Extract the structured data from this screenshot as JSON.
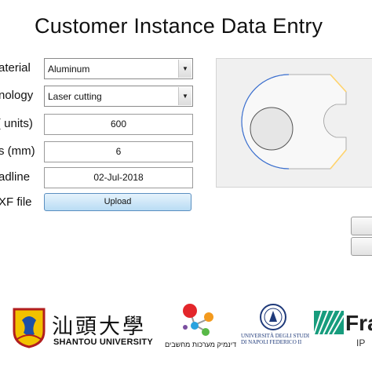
{
  "window": {
    "title": "Customer Instance Data Entry"
  },
  "form": {
    "material": {
      "label": "aterial",
      "value": "Aluminum",
      "icon": "chevron-down-icon"
    },
    "technology": {
      "label": "nology",
      "value": "Laser cutting",
      "icon": "chevron-down-icon"
    },
    "quantity": {
      "label": "( units)",
      "value": "600"
    },
    "thickness": {
      "label": "s (mm)",
      "value": "6"
    },
    "deadline": {
      "label": "adline",
      "value": "02-Jul-2018"
    },
    "dxf": {
      "label": "XF file",
      "button": "Upload"
    }
  },
  "preview": {
    "icon": "part-preview-drawing"
  },
  "logos": {
    "shantou": {
      "cjk": "汕頭大學",
      "name": "SHANTOU UNIVERSITY"
    },
    "hebrew": {
      "text": "דינמיק מערכות מחשבים"
    },
    "naples": {
      "line1": "UNIVERSITÀ DEGLI STUDI",
      "line2": "DI NAPOLI FEDERICO II"
    },
    "fraunhofer": {
      "text": "Fra",
      "sub": "IP"
    }
  },
  "colors": {
    "upload_blue": "#b9dcf4",
    "preview_bg": "#f0f0f0",
    "preview_edge": "#ffd36b",
    "preview_outline": "#3a6fd0"
  }
}
